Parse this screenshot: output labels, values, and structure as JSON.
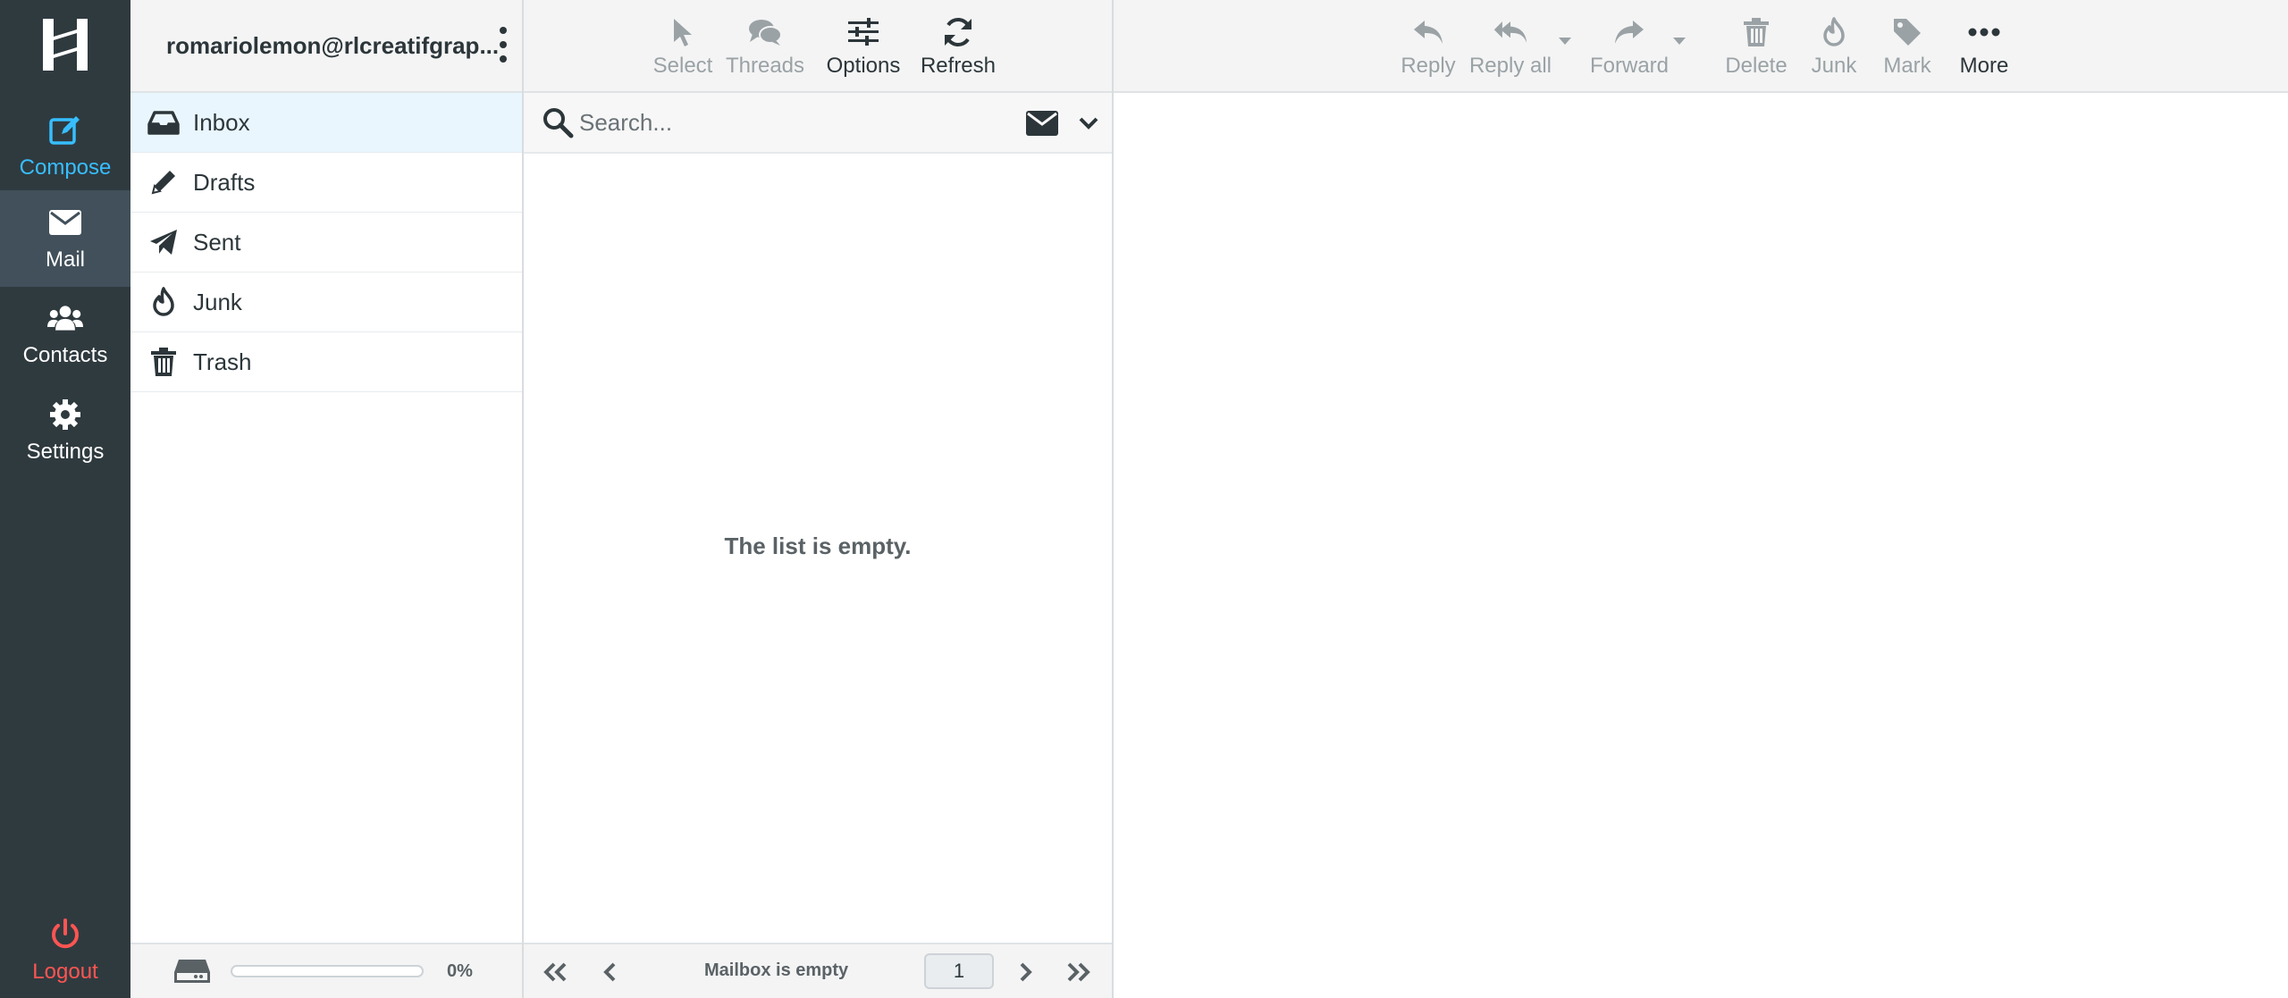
{
  "rail": {
    "compose": "Compose",
    "mail": "Mail",
    "contacts": "Contacts",
    "settings": "Settings",
    "logout": "Logout"
  },
  "folders": {
    "account": "romariolemon@rlcreatifgrap...",
    "items": [
      {
        "label": "Inbox",
        "icon": "inbox-icon"
      },
      {
        "label": "Drafts",
        "icon": "pencil-icon"
      },
      {
        "label": "Sent",
        "icon": "paper-plane-icon"
      },
      {
        "label": "Junk",
        "icon": "fire-icon"
      },
      {
        "label": "Trash",
        "icon": "trash-icon"
      }
    ],
    "quota_percent": 0,
    "quota_text": "0%"
  },
  "list_toolbar": {
    "select": "Select",
    "threads": "Threads",
    "options": "Options",
    "refresh": "Refresh"
  },
  "search": {
    "placeholder": "Search..."
  },
  "list": {
    "empty_message": "The list is empty.",
    "footer_status": "Mailbox is empty",
    "page": "1"
  },
  "message_toolbar": {
    "reply": "Reply",
    "reply_all": "Reply all",
    "forward": "Forward",
    "delete": "Delete",
    "junk": "Junk",
    "mark": "Mark",
    "more": "More"
  },
  "colors": {
    "rail_bg": "#2f3a3f",
    "accent": "#37beff",
    "logout": "#ff5552",
    "selected_folder_bg": "#e9f6fd"
  }
}
